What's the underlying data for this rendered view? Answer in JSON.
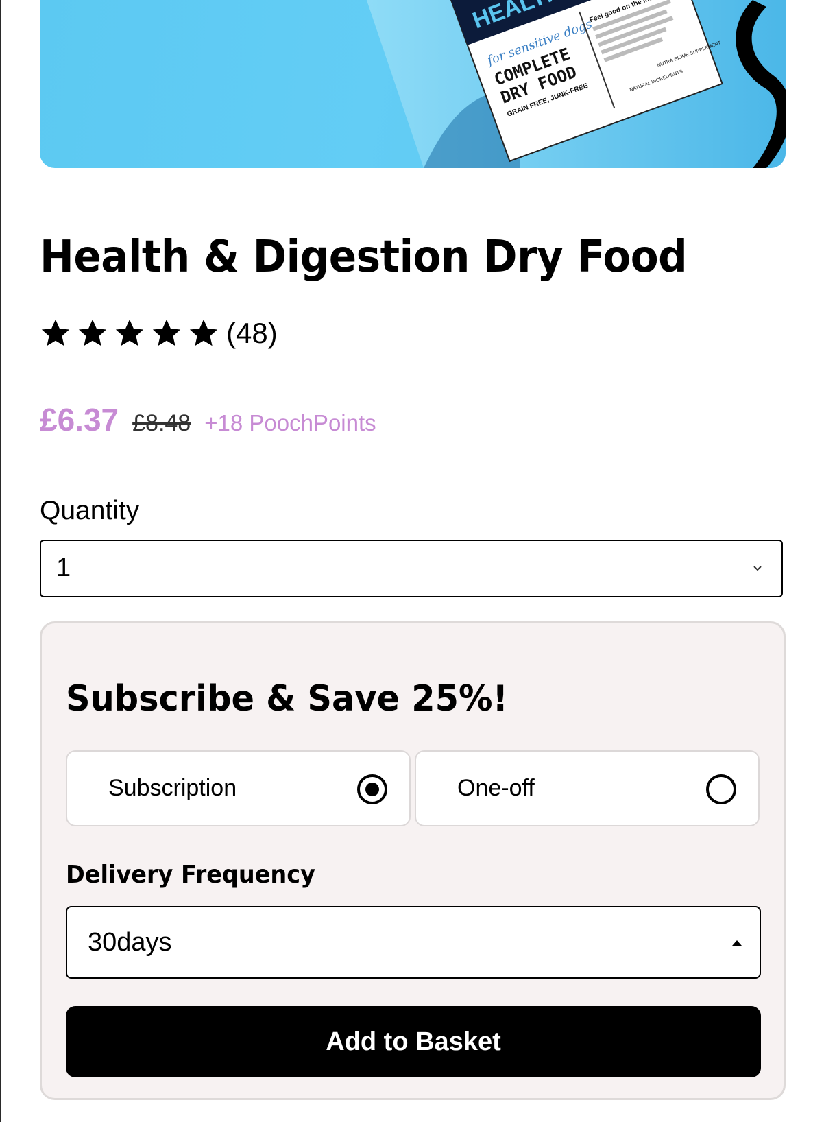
{
  "colors": {
    "accent": "#c78bd4",
    "hero_blue": "#62ccf4",
    "card_bg": "#f7f2f2",
    "button_bg": "#000000"
  },
  "product": {
    "name": "Health & Digestion Dry Food",
    "rating_stars": 5,
    "rating_count": "(48)",
    "price_now": "£6.37",
    "price_was": "£8.48",
    "points": "+18 PoochPoints"
  },
  "hero_image": {
    "alt": "Health & Digestion dry food bag",
    "pack_text": {
      "brand": "HEALTH & DIGESTION",
      "tagline": "for sensitive dogs",
      "line1": "COMPLETE",
      "line2": "DRY FOOD",
      "line3": "GRAIN FREE, JUNK-FREE",
      "side_heading": "Feel good on the inside",
      "badge1": "NATURAL INGREDIENTS",
      "badge2": "NUTRA-BIOME SUPPLEMENT"
    }
  },
  "quantity": {
    "label": "Quantity",
    "value": "1"
  },
  "subscribe": {
    "title": "Subscribe & Save 25%!",
    "options": [
      {
        "label": "Subscription",
        "selected": true
      },
      {
        "label": "One-off",
        "selected": false
      }
    ],
    "frequency_label": "Delivery Frequency",
    "frequency_value": "30days",
    "add_button": "Add to Basket"
  },
  "icons": [
    "star-icon",
    "chevron-down-icon",
    "radio-selected-icon",
    "radio-empty-icon",
    "caret-up-icon"
  ]
}
